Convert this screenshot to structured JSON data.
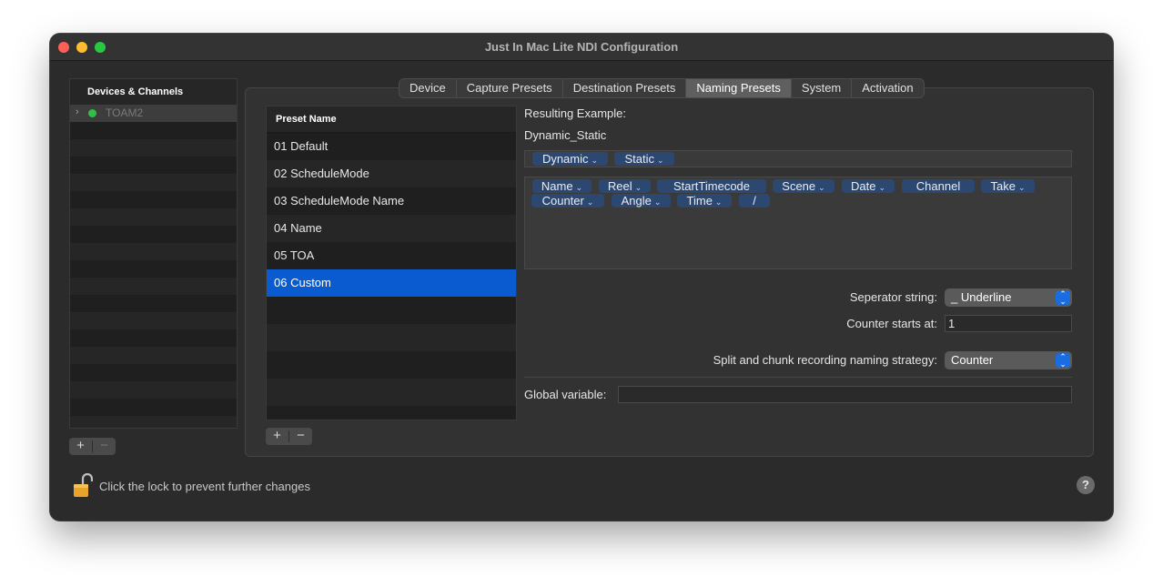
{
  "window": {
    "title": "Just In Mac Lite NDI Configuration"
  },
  "sidebar": {
    "header": "Devices & Channels",
    "items": [
      {
        "label": "TOAM2",
        "status_color": "#30c048"
      }
    ],
    "add_label": "+",
    "remove_label": "−"
  },
  "tabs": [
    {
      "label": "Device"
    },
    {
      "label": "Capture Presets"
    },
    {
      "label": "Destination Presets"
    },
    {
      "label": "Naming Presets",
      "active": true
    },
    {
      "label": "System"
    },
    {
      "label": "Activation"
    }
  ],
  "presets": {
    "header": "Preset Name",
    "items": [
      {
        "label": "01 Default"
      },
      {
        "label": "02 ScheduleMode"
      },
      {
        "label": "03 ScheduleMode Name"
      },
      {
        "label": "04 Name"
      },
      {
        "label": "05 TOA"
      },
      {
        "label": "06 Custom",
        "selected": true
      }
    ],
    "add_label": "+",
    "remove_label": "−"
  },
  "naming": {
    "resulting_example_label": "Resulting Example:",
    "resulting_example_value": "Dynamic_Static",
    "active_tokens": [
      {
        "label": "Dynamic",
        "menu": true
      },
      {
        "label": "Static",
        "menu": true
      }
    ],
    "available_tokens": [
      {
        "label": "Name",
        "menu": true
      },
      {
        "label": "Reel",
        "menu": true
      },
      {
        "label": "StartTimecode",
        "menu": false
      },
      {
        "label": "Scene",
        "menu": true
      },
      {
        "label": "Date",
        "menu": true
      },
      {
        "label": "Channel",
        "menu": false
      },
      {
        "label": "Take",
        "menu": true
      },
      {
        "label": "Counter",
        "menu": true
      },
      {
        "label": "Angle",
        "menu": true
      },
      {
        "label": "Time",
        "menu": true
      },
      {
        "label": "/",
        "menu": false
      }
    ],
    "separator_label": "Seperator string:",
    "separator_value": "_ Underline",
    "counter_label": "Counter starts at:",
    "counter_value": "1",
    "split_label": "Split and chunk recording naming strategy:",
    "split_value": "Counter",
    "global_label": "Global variable:",
    "global_value": ""
  },
  "footer": {
    "lock_text": "Click the lock to prevent further changes",
    "help_label": "?"
  },
  "colors": {
    "accent": "#0a5ad0",
    "token": "#2c4870"
  }
}
